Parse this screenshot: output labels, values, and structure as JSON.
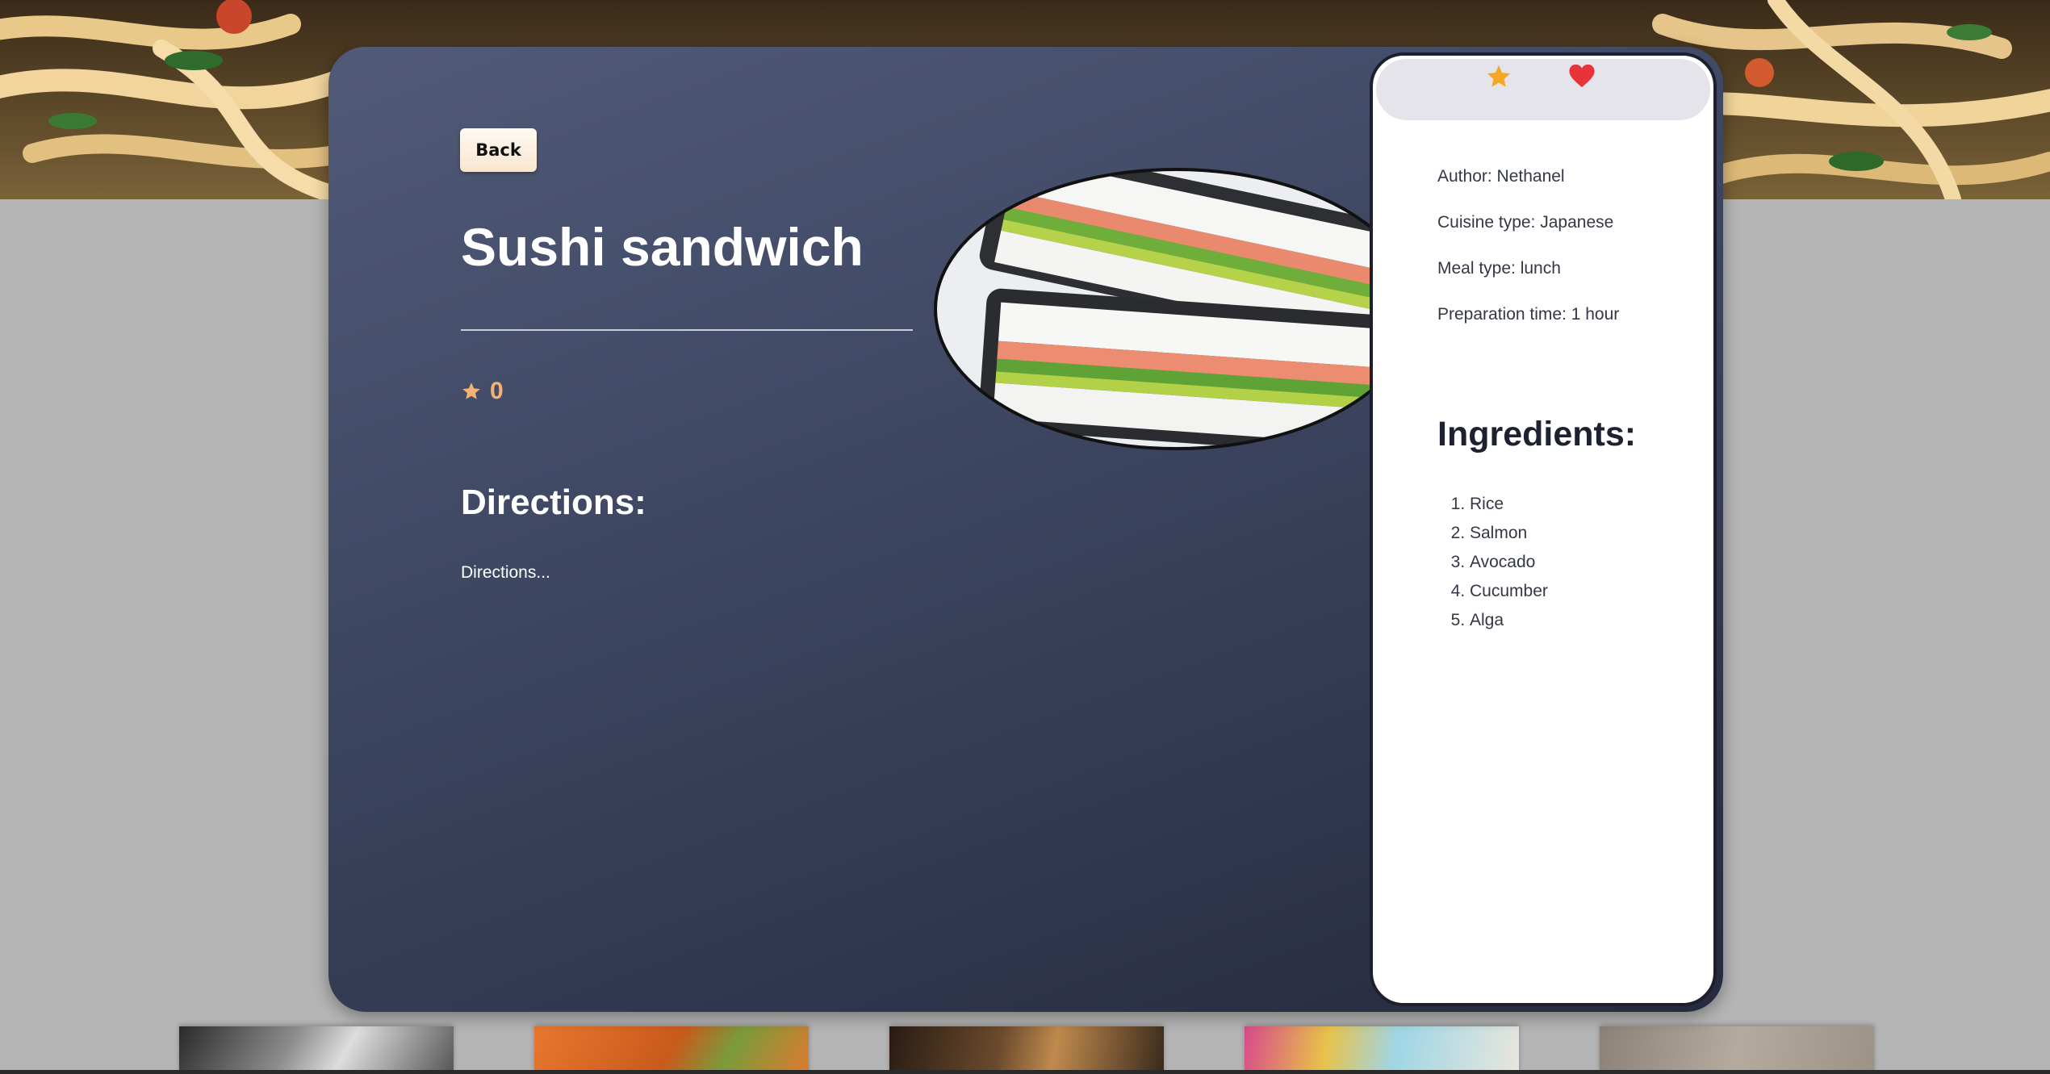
{
  "recipe": {
    "back_label": "Back",
    "title": "Sushi sandwich",
    "rating": "0",
    "directions_heading": "Directions:",
    "directions_text": "Directions...",
    "image_alt": "sushi sandwich photo"
  },
  "details": {
    "author": "Author: Nethanel",
    "cuisine": "Cuisine type: Japanese",
    "meal_type": "Meal type: lunch",
    "prep_time": "Preparation time: 1 hour"
  },
  "ingredients": {
    "heading": "Ingredients:",
    "items": [
      "Rice",
      "Salmon",
      "Avocado",
      "Cucumber",
      "Alga"
    ]
  },
  "actions": {
    "favorite_icon": "star-icon",
    "like_icon": "heart-icon"
  },
  "colors": {
    "modal_gradient_start": "#515a77",
    "modal_gradient_end": "#262a3e",
    "rating_accent": "#f6b274",
    "star_accent": "#f5a623",
    "heart_accent": "#e8333a",
    "back_button_bg": "#fbeedd"
  }
}
